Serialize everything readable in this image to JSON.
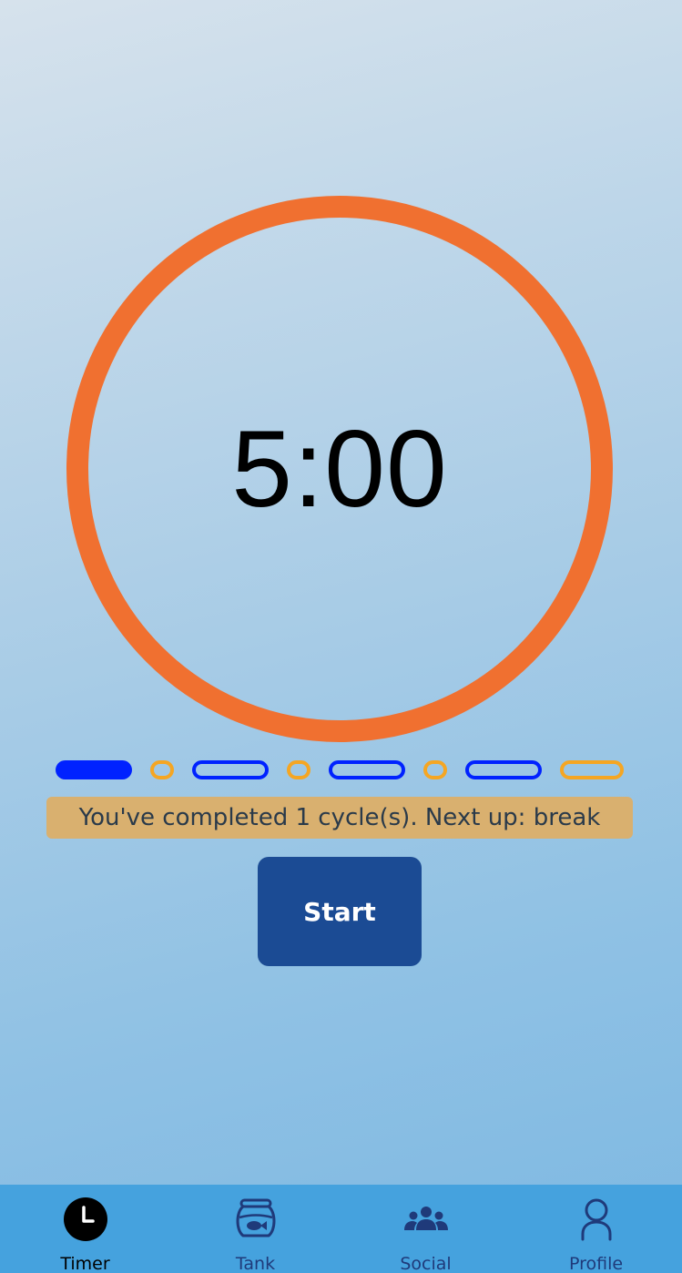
{
  "timer": {
    "time": "5:00"
  },
  "cycles": {
    "colors": {
      "work": "#0022ff",
      "break": "#f5a623"
    },
    "items": [
      {
        "kind": "work",
        "state": "completed"
      },
      {
        "kind": "short-break",
        "state": "pending"
      },
      {
        "kind": "work",
        "state": "pending"
      },
      {
        "kind": "short-break",
        "state": "pending"
      },
      {
        "kind": "work",
        "state": "pending"
      },
      {
        "kind": "short-break",
        "state": "pending"
      },
      {
        "kind": "work",
        "state": "pending"
      },
      {
        "kind": "long-break",
        "state": "pending"
      }
    ]
  },
  "status": {
    "message": "You've completed 1 cycle(s). Next up: break"
  },
  "controls": {
    "start_label": "Start"
  },
  "colors": {
    "ring": "#f07030",
    "banner": "#d9b06f",
    "button": "#1b4b94",
    "tab_bar": "#45a2de"
  },
  "tabs": [
    {
      "id": "timer",
      "label": "Timer",
      "icon": "clock-icon",
      "active": true
    },
    {
      "id": "tank",
      "label": "Tank",
      "icon": "fishbowl-icon",
      "active": false
    },
    {
      "id": "social",
      "label": "Social",
      "icon": "people-group-icon",
      "active": false
    },
    {
      "id": "profile",
      "label": "Profile",
      "icon": "person-icon",
      "active": false
    }
  ]
}
